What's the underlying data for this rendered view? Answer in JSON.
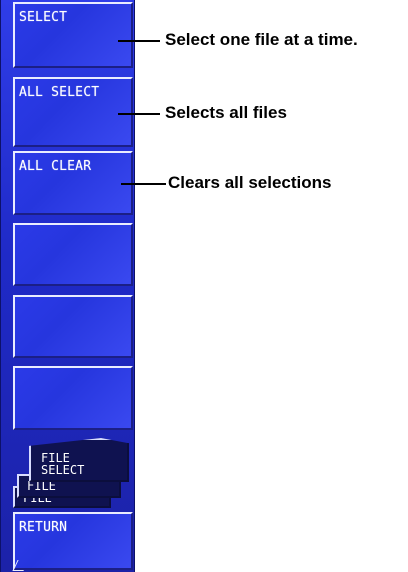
{
  "softkeys": {
    "select_label": "SELECT",
    "all_select_label": "ALL SELECT",
    "all_clear_label": "ALL CLEAR",
    "return_label": "RETURN"
  },
  "file_select_tabs": {
    "front_label": "FILE\nSELECT",
    "mid_label": "FILE",
    "back_label": "FILE"
  },
  "callouts": {
    "select": "Select one file at a time.",
    "all_select": "Selects all files",
    "all_clear": "Clears all selections"
  },
  "colors": {
    "softkey_blue": "#2636de",
    "softkey_highlight": "#e9ecff",
    "text": "#000000"
  }
}
